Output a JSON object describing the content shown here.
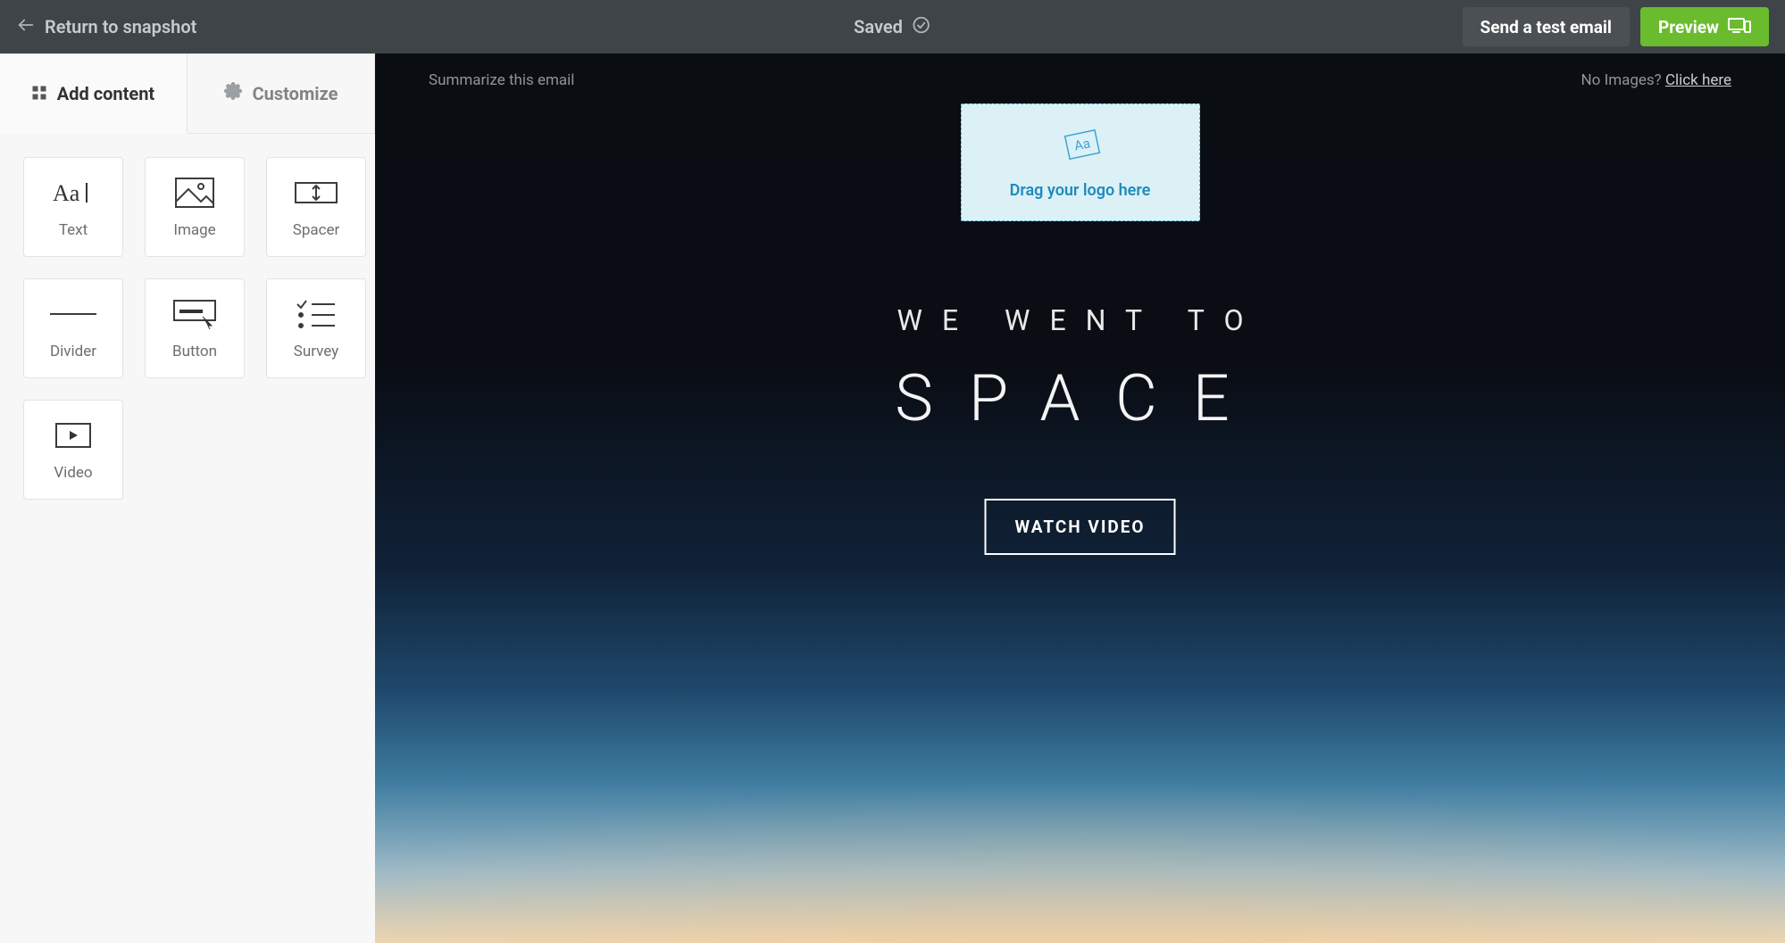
{
  "topbar": {
    "return_label": "Return to snapshot",
    "saved_label": "Saved",
    "send_test_label": "Send a test email",
    "preview_label": "Preview"
  },
  "sidebar": {
    "tabs": {
      "add_content": "Add content",
      "customize": "Customize"
    },
    "blocks": {
      "text": "Text",
      "image": "Image",
      "spacer": "Spacer",
      "divider": "Divider",
      "button": "Button",
      "survey": "Survey",
      "video": "Video"
    }
  },
  "email": {
    "top_left": "Summarize this email",
    "top_right_prefix": "No Images? ",
    "top_right_link": "Click here",
    "logo_drop": "Drag your logo here",
    "hero_line1": "WE WENT TO",
    "hero_line2": "SPACE",
    "hero_button": "WATCH VIDEO"
  }
}
